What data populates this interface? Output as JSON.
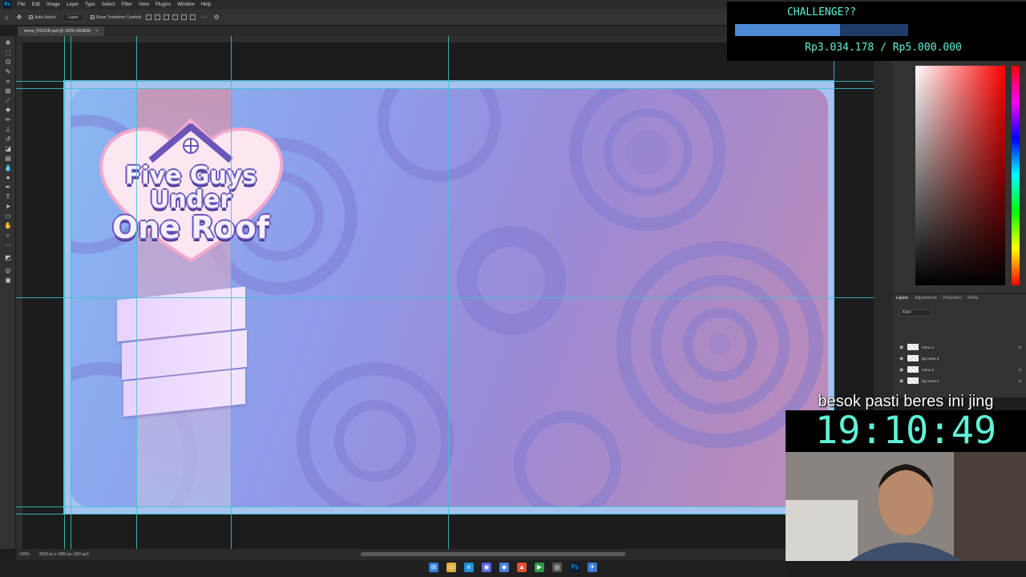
{
  "menubar": {
    "items": [
      "File",
      "Edit",
      "Image",
      "Layer",
      "Type",
      "Select",
      "Filter",
      "View",
      "Plugins",
      "Window",
      "Help"
    ]
  },
  "options": {
    "auto_select_label": "Auto-Select:",
    "layer_select_value": "Layer",
    "transform_label": "Show Transform Controls"
  },
  "document": {
    "tab_title": "menu_FGUOR.psd @ 100% (RGB/8)",
    "zoom": "100%",
    "doc_size": "3520 px x 1080 px (300 ppi)"
  },
  "artwork": {
    "logo_line1": "Five Guys",
    "logo_line2": "Under",
    "logo_line3": "One Roof"
  },
  "layers": {
    "tabs": [
      "Layers",
      "Adjustments",
      "Properties",
      "Paths"
    ],
    "kind_label": "Kind",
    "rows": [
      {
        "name": "menu 3",
        "fx": "fx"
      },
      {
        "name": "bg menu 3",
        "fx": ""
      },
      {
        "name": "menu 2",
        "fx": "fx"
      },
      {
        "name": "bg menu 2",
        "fx": "fx"
      }
    ]
  },
  "challenge": {
    "title": "CHALLENGE??",
    "amount_text": "Rp3.034.178 / Rp5.000.000",
    "progress_fraction": 0.607
  },
  "overlay": {
    "note": "besok pasti beres ini jing",
    "timer": "19:10:49"
  },
  "colors": {
    "accent": "#5ff2d6",
    "guide": "#39c6d1",
    "progress": "#4f8ad8"
  }
}
